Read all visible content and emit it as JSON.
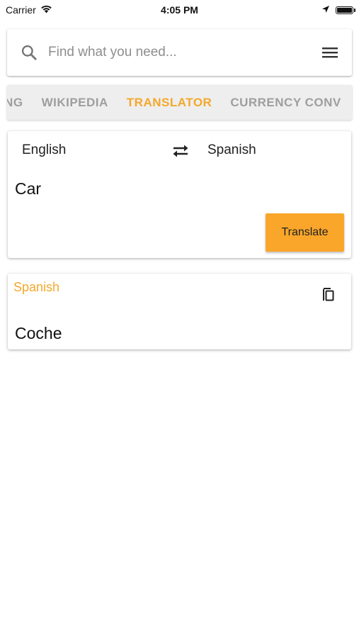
{
  "status_bar": {
    "carrier": "Carrier",
    "time": "4:05 PM",
    "icons": [
      "wifi-icon",
      "location-arrow-icon",
      "battery-icon"
    ]
  },
  "search": {
    "placeholder": "Find what you need...",
    "value": ""
  },
  "tabs": [
    {
      "label": "PING",
      "active": false
    },
    {
      "label": "WIKIPEDIA",
      "active": false
    },
    {
      "label": "TRANSLATOR",
      "active": true
    },
    {
      "label": "CURRENCY CONV",
      "active": false
    }
  ],
  "translator": {
    "source_language": "English",
    "target_language": "Spanish",
    "source_text": "Car",
    "translate_label": "Translate"
  },
  "result": {
    "language": "Spanish",
    "text": "Coche"
  },
  "colors": {
    "accent": "#f4a82b",
    "button": "#f9a62a",
    "tab_inactive": "#9e9e9e",
    "tab_strip_bg": "#eeeeee"
  }
}
